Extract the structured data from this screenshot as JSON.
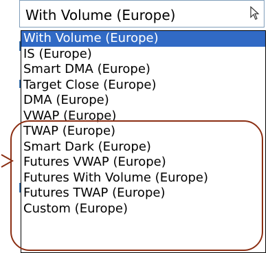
{
  "combo": {
    "selected_value": "With Volume (Europe)",
    "arrow_icon": "cursor-icon"
  },
  "dropdown": {
    "items": [
      {
        "label": "With Volume (Europe)",
        "selected": true
      },
      {
        "label": "IS (Europe)",
        "selected": false
      },
      {
        "label": "Smart DMA (Europe)",
        "selected": false
      },
      {
        "label": "Target Close (Europe)",
        "selected": false
      },
      {
        "label": "DMA (Europe)",
        "selected": false
      },
      {
        "label": "VWAP (Europe)",
        "selected": false
      },
      {
        "label": "TWAP (Europe)",
        "selected": false
      },
      {
        "label": "Smart Dark (Europe)",
        "selected": false
      },
      {
        "label": "Futures VWAP (Europe)",
        "selected": false
      },
      {
        "label": "Futures With Volume (Europe)",
        "selected": false
      },
      {
        "label": "Futures TWAP (Europe)",
        "selected": false
      },
      {
        "label": "Custom (Europe)",
        "selected": false
      }
    ]
  },
  "colors": {
    "selection": "#316ac5",
    "annotation": "#8b2e12"
  }
}
